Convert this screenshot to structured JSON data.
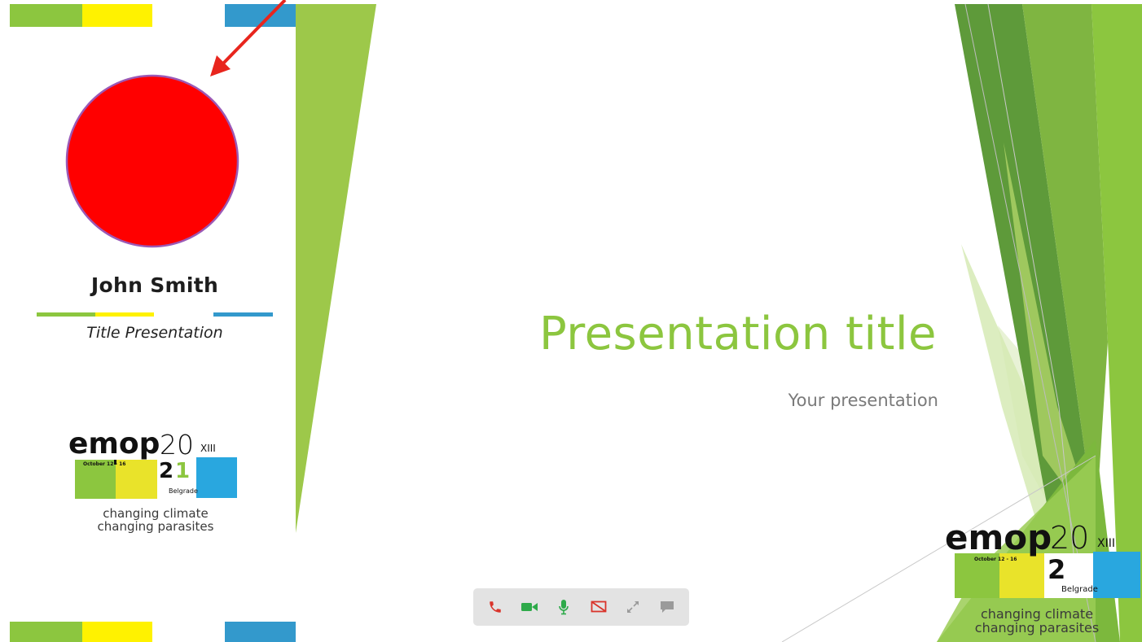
{
  "speaker": {
    "name": "John Smith",
    "title": "Title Presentation"
  },
  "slide": {
    "title": "Presentation title",
    "subtitle": "Your presentation"
  },
  "logo": {
    "word": "emop",
    "year": "20",
    "roman": "XIII",
    "dates": "October 12 - 16",
    "digit_two": "2",
    "digit_one": "1",
    "city": "Belgrade",
    "tagline_1": "changing climate",
    "tagline_2": "changing parasites"
  },
  "toolbar": {
    "buttons": [
      {
        "icon": "phone-hangup-icon",
        "color": "#d9342b"
      },
      {
        "icon": "video-camera-icon",
        "color": "#2eaa4a"
      },
      {
        "icon": "microphone-icon",
        "color": "#2eaa4a"
      },
      {
        "icon": "screen-share-off-icon",
        "color": "#d9342b"
      },
      {
        "icon": "expand-icon",
        "color": "#9a9a9a"
      },
      {
        "icon": "chat-icon",
        "color": "#9a9a9a"
      }
    ]
  },
  "colors": {
    "accent_green": "#8cc63f",
    "accent_yellow": "#fff200",
    "accent_blue": "#3399cc",
    "avatar_fill": "#ff0000",
    "avatar_border": "#9b59b6",
    "arrow": "#e8251d"
  }
}
